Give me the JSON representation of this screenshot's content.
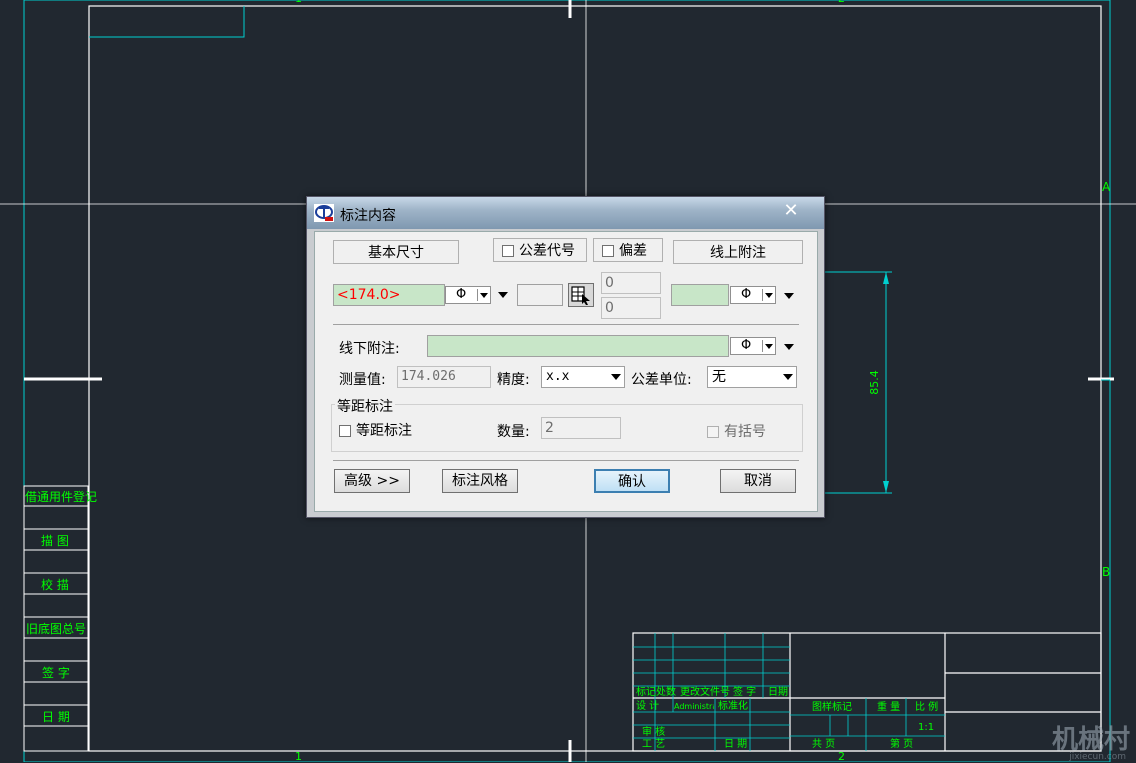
{
  "drawing": {
    "zone_labels": {
      "top_1": "1",
      "top_2": "2",
      "right_a": "A",
      "right_b": "B",
      "bottom_1": "1",
      "bottom_2": "2"
    },
    "dimension_value": "85.4",
    "left_strip": [
      "借通用件登记",
      "描 图",
      "校 描",
      "旧底图总号",
      "签 字",
      "日 期"
    ],
    "title_block": {
      "row_labels": [
        "标记",
        "处数",
        "更改文件号",
        "签 字",
        "日期"
      ],
      "row2": [
        "设 计",
        "Administrator",
        "标准化",
        "图样标记",
        "重 量",
        "比 例"
      ],
      "scale": "1:1",
      "row3": [
        "审 核"
      ],
      "row4": [
        "工 艺",
        "日 期",
        "共 页",
        "第 页"
      ]
    },
    "watermark": "机械村",
    "watermark_sub": "jixiecun.com"
  },
  "dialog": {
    "title": "标注内容",
    "close_glyph": "✕",
    "headers": {
      "basic_size": "基本尺寸",
      "tolerance_code": "公差代号",
      "deviation": "偏差",
      "upper_note": "线上附注"
    },
    "basic_value": "<174.0>",
    "phi_symbol": "Φ",
    "upper_deviation": "0",
    "lower_deviation": "0",
    "lower_note_label": "线下附注:",
    "measured_label": "测量值:",
    "measured_value": "174.026",
    "precision_label": "精度:",
    "precision_value": "x.x",
    "tol_unit_label": "公差单位:",
    "tol_unit_value": "无",
    "equidistant_group": "等距标注",
    "equidistant_check": "等距标注",
    "count_label": "数量:",
    "count_value": "2",
    "bracket_label": "有括号",
    "buttons": {
      "advanced": "高级 >>",
      "style": "标注风格",
      "ok": "确认",
      "cancel": "取消"
    },
    "colors": {
      "accent": "#3c7fb1",
      "basic_text": "#ff0000",
      "field_green": "#c8e6c8"
    }
  }
}
